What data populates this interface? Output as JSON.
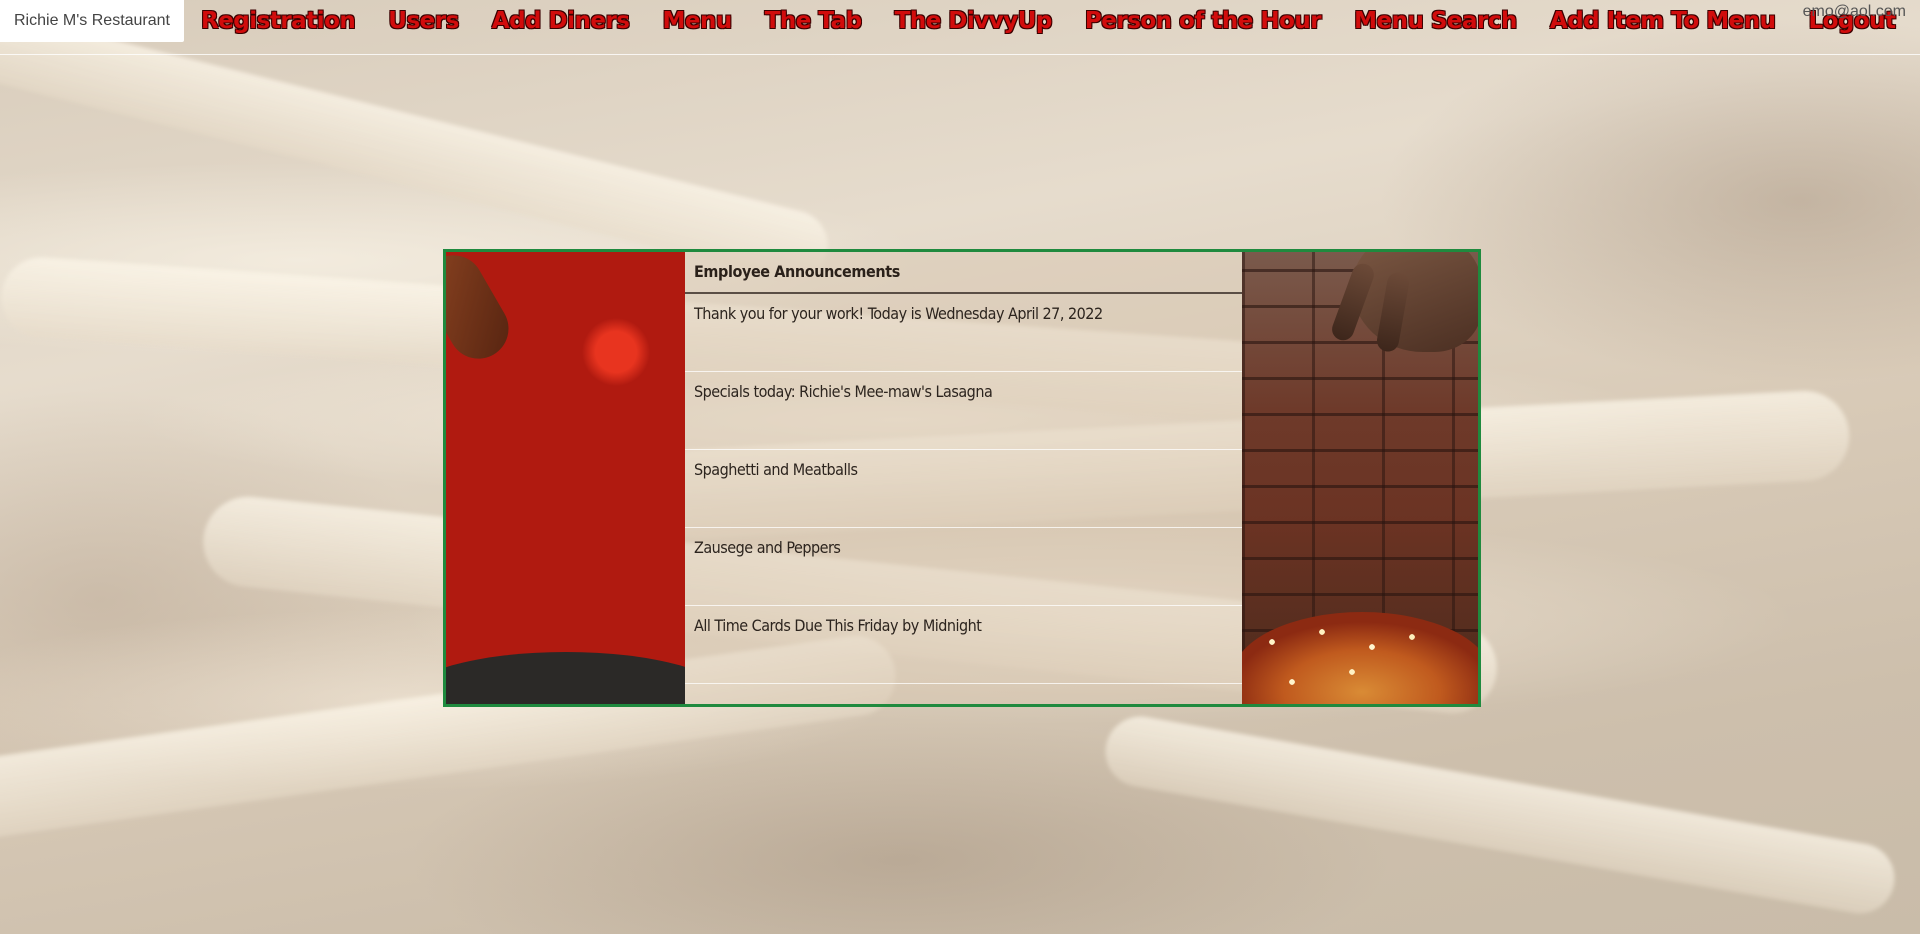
{
  "navbar": {
    "brand": "Richie M's Restaurant",
    "links": [
      "Registration",
      "Users",
      "Add Diners",
      "Menu",
      "The Tab",
      "The DivvyUp",
      "Person of the Hour",
      "Menu Search",
      "Add Item To Menu",
      "Logout"
    ],
    "user_email": "emo@aol.com",
    "link_color": "#d10c0c"
  },
  "announcements": {
    "header": "Employee Announcements",
    "items": [
      "Thank you for your work! Today is Wednesday April 27, 2022",
      "Specials today: Richie's Mee-maw's Lasagna",
      "Spaghetti and Meatballs",
      "Zausege and Peppers",
      "All Time Cards Due This Friday by Midnight"
    ],
    "border_color": "#1f8a3e"
  },
  "images": {
    "left": "cherry-tomatoes-in-pan",
    "right": "hand-over-spaghetti",
    "background": "fresh-pasta-noodles"
  }
}
